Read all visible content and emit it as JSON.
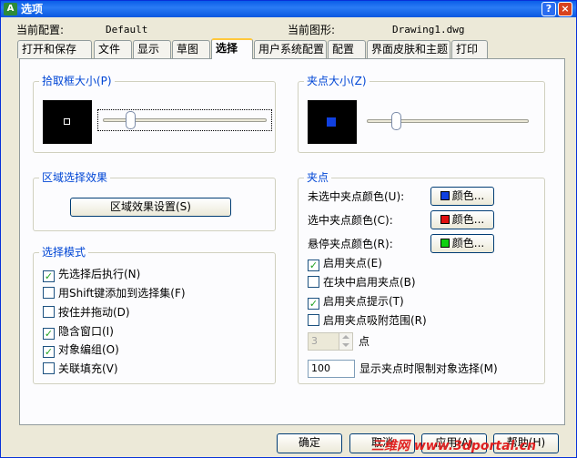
{
  "window": {
    "title": "选项",
    "app_icon": "autocad-icon",
    "help_glyph": "?",
    "close_glyph": "×"
  },
  "profile": {
    "label": "当前配置:",
    "value": "Default",
    "drawing_label": "当前图形:",
    "drawing_value": "Drawing1.dwg"
  },
  "tabs": [
    {
      "label": "打开和保存"
    },
    {
      "label": "文件"
    },
    {
      "label": "显示"
    },
    {
      "label": "草图"
    },
    {
      "label": "选择",
      "active": true
    },
    {
      "label": "用户系统配置"
    },
    {
      "label": "配置"
    },
    {
      "label": "界面皮肤和主题"
    },
    {
      "label": "打印"
    }
  ],
  "pickbox": {
    "title": "拾取框大小(P)"
  },
  "grip_size": {
    "title": "夹点大小(Z)"
  },
  "region": {
    "title": "区域选择效果",
    "button": "区域效果设置(S)"
  },
  "selection_modes": {
    "title": "选择模式",
    "items": [
      {
        "label": "先选择后执行(N)",
        "checked": true
      },
      {
        "label": "用Shift键添加到选择集(F)",
        "checked": false
      },
      {
        "label": "按住并拖动(D)",
        "checked": false
      },
      {
        "label": "隐含窗口(I)",
        "checked": true
      },
      {
        "label": "对象编组(O)",
        "checked": true
      },
      {
        "label": "关联填充(V)",
        "checked": false
      }
    ]
  },
  "grips": {
    "title": "夹点",
    "unselected_label": "未选中夹点颜色(U):",
    "selected_label": "选中夹点颜色(C):",
    "hover_label": "悬停夹点颜色(R):",
    "color_button": "颜色...",
    "unselected_color": "#1040e0",
    "selected_color": "#e01010",
    "hover_color": "#10d010",
    "options": [
      {
        "label": "启用夹点(E)",
        "checked": true,
        "disabled": false
      },
      {
        "label": "在块中启用夹点(B)",
        "checked": false,
        "disabled": false
      },
      {
        "label": "启用夹点提示(T)",
        "checked": true,
        "disabled": false
      },
      {
        "label": "启用夹点吸附范围(R)",
        "checked": false,
        "disabled": false
      }
    ],
    "snap_value": "3",
    "snap_unit": "点",
    "limit_value": "100",
    "limit_label": "显示夹点时限制对象选择(M)"
  },
  "buttons": {
    "ok": "确定",
    "cancel": "取消",
    "apply": "应用(A)",
    "help": "帮助(H)"
  },
  "watermark": "三维网 www.3dportal.cn"
}
